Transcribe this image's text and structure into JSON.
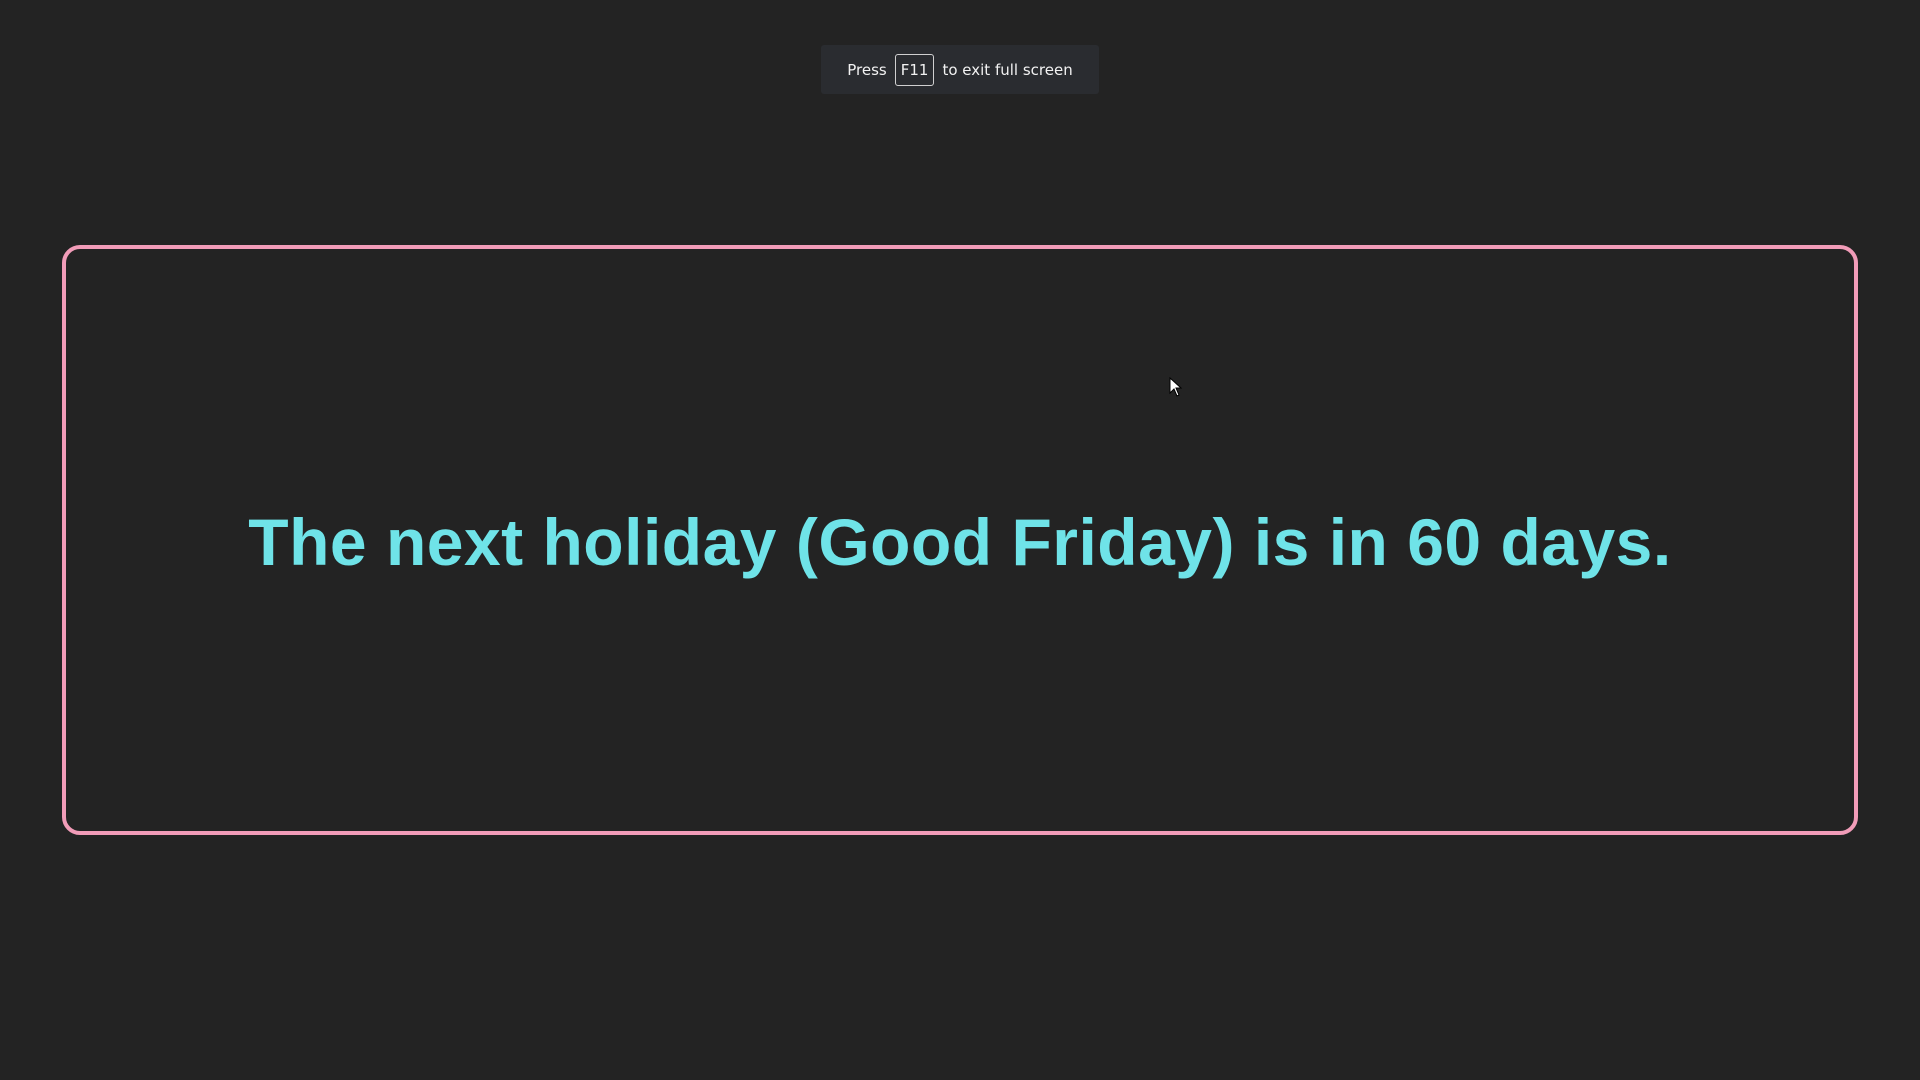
{
  "fullscreen_notice": {
    "prefix": "Press",
    "key": "F11",
    "suffix": "to exit full screen"
  },
  "holiday": {
    "message": "The next holiday (Good Friday) is in 60 days."
  },
  "colors": {
    "background": "#232323",
    "border": "#f19cb8",
    "message_text": "#6fe3e8"
  },
  "icons": {
    "cursor": "arrow-cursor-icon"
  }
}
